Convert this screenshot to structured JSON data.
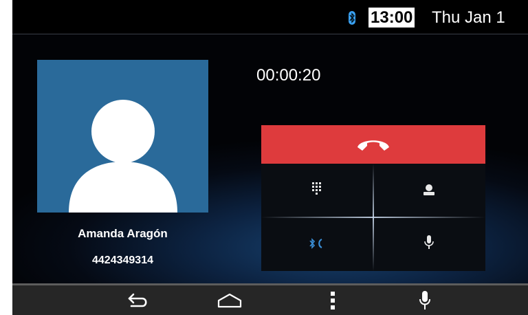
{
  "status_bar": {
    "time": "13:00",
    "date": "Thu Jan 1",
    "bluetooth_icon": "bluetooth-icon"
  },
  "contact": {
    "name": "Amanda Aragón",
    "number": "4424349314",
    "avatar_icon": "person-silhouette-icon"
  },
  "call": {
    "duration": "00:00:20",
    "end_call_icon": "phone-hangup-icon"
  },
  "controls": [
    {
      "icon": "dialpad-icon"
    },
    {
      "icon": "contact-icon"
    },
    {
      "icon": "bluetooth-audio-icon"
    },
    {
      "icon": "microphone-icon"
    }
  ],
  "navbar": [
    {
      "icon": "back-icon"
    },
    {
      "icon": "home-icon"
    },
    {
      "icon": "menu-icon"
    },
    {
      "icon": "voice-icon"
    }
  ],
  "colors": {
    "end_call": "#de3b3d",
    "avatar_bg": "#2a6a9a",
    "accent_blue": "#3a8ed6"
  }
}
